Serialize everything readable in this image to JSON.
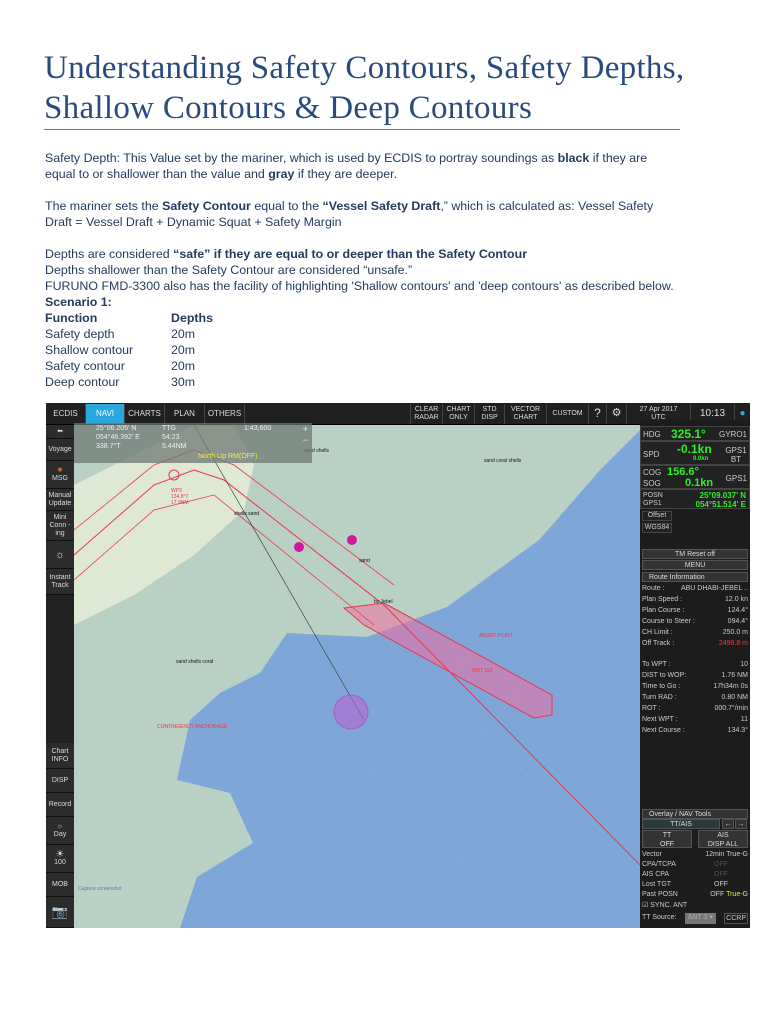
{
  "title": "Understanding Safety Contours, Safety Depths, Shallow Contours & Deep Contours",
  "paragraphs": {
    "p1_a": "Safety Depth: This Value set by the mariner, which is used by ECDIS to portray soundings as ",
    "p1_b": "black",
    "p1_c": " if they are equal to or shallower than the value and ",
    "p1_d": "gray",
    "p1_e": " if they are deeper.",
    "p2_a": "The mariner sets the ",
    "p2_b": "Safety Contour",
    "p2_c": " equal to the ",
    "p2_d": "“Vessel Safety Draft",
    "p2_e": ",” which is calculated as: Vessel Safety Draft = Vessel Draft + Dynamic Squat + Safety Margin",
    "p3_a": "Depths are considered ",
    "p3_b": "“safe” if they are equal to or deeper than the Safety Contour",
    "p4": "Depths shallower than the Safety Contour are considered “unsafe.”",
    "p5": "FURUNO FMD-3300 also has the facility of highlighting 'Shallow contours' and 'deep contours' as described below.",
    "scenario": "Scenario 1:"
  },
  "table": {
    "headers": [
      "Function",
      "Depths"
    ],
    "rows": [
      [
        "Safety depth",
        "20m"
      ],
      [
        "Shallow contour",
        "20m"
      ],
      [
        "Safety contour",
        "20m"
      ],
      [
        "Deep contour",
        "30m"
      ]
    ]
  },
  "ecdis": {
    "tabs": [
      "ECDIS",
      "NAVI",
      "CHARTS",
      "PLAN",
      "OTHERS"
    ],
    "toolbar": [
      "CLEAR RADAR",
      "CHART ONLY",
      "STD DISP",
      "VECTOR CHART",
      "CUSTOM"
    ],
    "date": "27 Apr 2017",
    "tz": "UTC",
    "time": "10:13",
    "cursor": {
      "lat": "25°06.205' N",
      "lon": "054°46.392' E",
      "brg": "338.7°T",
      "ttg_label": "TTG",
      "ttg": "54:23",
      "dist": "5.44NM",
      "scale": "1:43,600",
      "mode": "North Up RM(OFF)"
    },
    "left_buttons": [
      "Voyage",
      "MSG",
      "Manual Update",
      "Mini Conn -ing",
      "Instant Track",
      "Chart INFO",
      "DISP",
      "Record",
      "Day",
      "100",
      "MOB"
    ],
    "nav": {
      "hdg_label": "HDG",
      "hdg": "325.1°",
      "hdg_src": "GYRO1",
      "spd_label": "SPD",
      "spd": "-0.1kn",
      "spd_sub": "0.0kn",
      "spd_src": "GPS1 BT",
      "cog_label": "COG",
      "cog": "156.6°",
      "sog_label": "SOG",
      "sog": "0.1kn",
      "cog_src": "GPS1",
      "posn_label": "POSN GPS1",
      "lat": "25°09.037' N",
      "lon": "054°51.514' E",
      "offset": "Offset",
      "datum": "WGS84",
      "tm_reset": "TM Reset off",
      "menu": "MENU"
    },
    "route_info": {
      "header": "Route Information",
      "items": [
        [
          "Route :",
          "ABU DHABI-JEBEL .."
        ],
        [
          "Plan Speed :",
          "12.0 kn"
        ],
        [
          "Plan Course :",
          "124.4°"
        ],
        [
          "Course to Steer :",
          "094.4°"
        ],
        [
          "CH Limit :",
          "250.0 m"
        ],
        [
          "Off Track :",
          "2496.8 m"
        ],
        [
          "To WPT :",
          "10"
        ],
        [
          "DIST to WOP:",
          "1.76 NM"
        ],
        [
          "Time to Go :",
          "17h34m 0s"
        ],
        [
          "Turn RAD :",
          "0.80 NM"
        ],
        [
          "ROT :",
          "000.7°/min"
        ],
        [
          "Next WPT :",
          "11"
        ],
        [
          "Next Course :",
          "134.3°"
        ]
      ]
    },
    "overlay": {
      "header": "Overlay / NAV Tools",
      "tab": "TT/AIS",
      "tt": "TT",
      "tt_state": "OFF",
      "ais": "AIS",
      "ais_state": "DISP ALL",
      "vector": "Vector",
      "vector_val": "12min True-G",
      "cpa": "CPA/TCPA",
      "cpa_val": "OFF",
      "ais_cpa": "AIS CPA",
      "ais_cpa_val": "OFF",
      "lost": "Lost TGT",
      "lost_val": "OFF",
      "past": "Past POSN",
      "past_val": "OFF",
      "past_mode": "True-G",
      "sync": "SYNC. ANT",
      "tt_source": "TT Source:",
      "tt_source_val": "ANT 3",
      "ccrp": "CCRP"
    },
    "map_labels": [
      "sand shells",
      "sand coral shells",
      "shells sand",
      "sand",
      "sand shells coral",
      "CONTINGENCY ANCHORAGE",
      "ABORT POINT",
      "NMT 193",
      "by Jebel",
      "Capture screenshot",
      "WP3",
      "134.8°T",
      "17.9NM"
    ],
    "colors": {
      "water": "#7fa6d8",
      "shallow": "#b9d1c5",
      "land": "#dfe8d2",
      "route": "#e8364a",
      "accent": "#28a8dc",
      "nav_green": "#2df02d"
    }
  }
}
